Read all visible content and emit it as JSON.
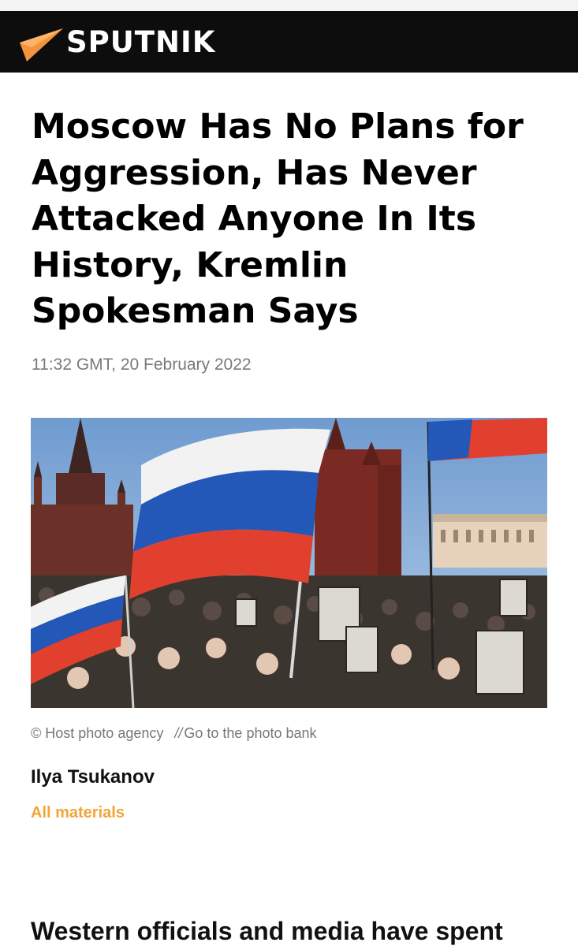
{
  "brand": {
    "name": "SPUTNIK",
    "accent_color": "#f5923e",
    "header_bg": "#0d0d0d",
    "logo_icon": "sputnik-orange-triangle-icon"
  },
  "article": {
    "headline": "Moscow Has No Plans for Aggression, Has Never Attacked Anyone In Its History, Kremlin Spokesman Says",
    "dateline": "11:32 GMT, 20 February 2022",
    "photo": {
      "credit": "© Host photo agency",
      "separator": "//",
      "bank_link": "Go to the photo bank"
    },
    "author": "Ilya Tsukanov",
    "all_materials": "All materials",
    "body_start": "Western officials and media have spent"
  }
}
